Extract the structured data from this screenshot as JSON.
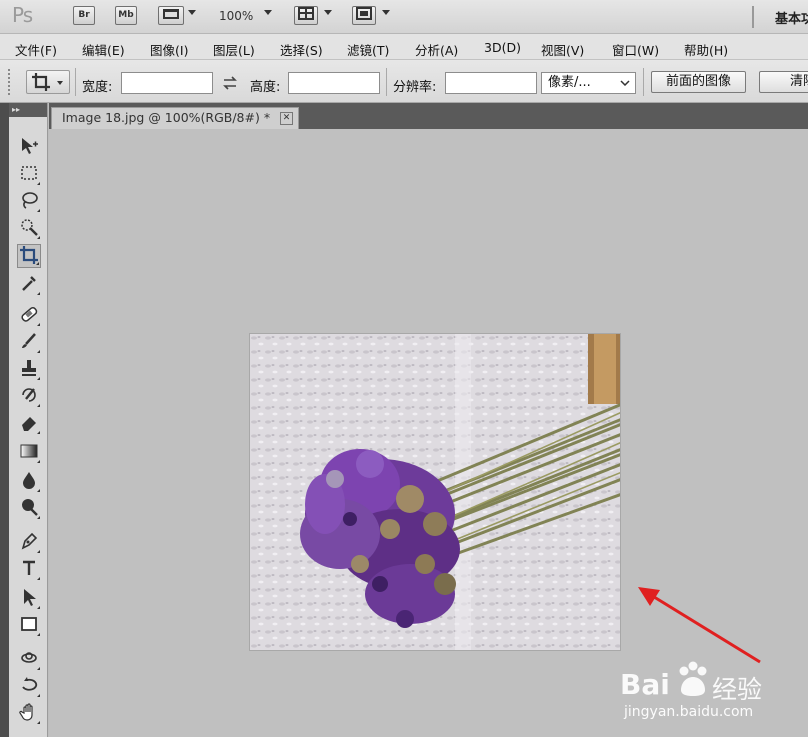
{
  "app": {
    "logo": "Ps",
    "bridge_label": "Br",
    "minibridge_label": "Mb",
    "zoom": "100%",
    "workspace": "基本功"
  },
  "menu": [
    "文件(F)",
    "编辑(E)",
    "图像(I)",
    "图层(L)",
    "选择(S)",
    "滤镜(T)",
    "分析(A)",
    "3D(D)",
    "视图(V)",
    "窗口(W)",
    "帮助(H)"
  ],
  "options": {
    "width_label": "宽度:",
    "height_label": "高度:",
    "resolution_label": "分辨率:",
    "units": "像素/...",
    "front_image_btn": "前面的图像",
    "clear_btn": "清除"
  },
  "document": {
    "tab_title": "Image 18.jpg @ 100%(RGB/8#) *",
    "close_glyph": "✕"
  },
  "colors": {
    "arrow": "#e02020",
    "canvas": "#c0c0c0"
  },
  "watermark": {
    "brand": "Bai",
    "brand2": "经验",
    "url": "jingyan.baidu.com"
  }
}
